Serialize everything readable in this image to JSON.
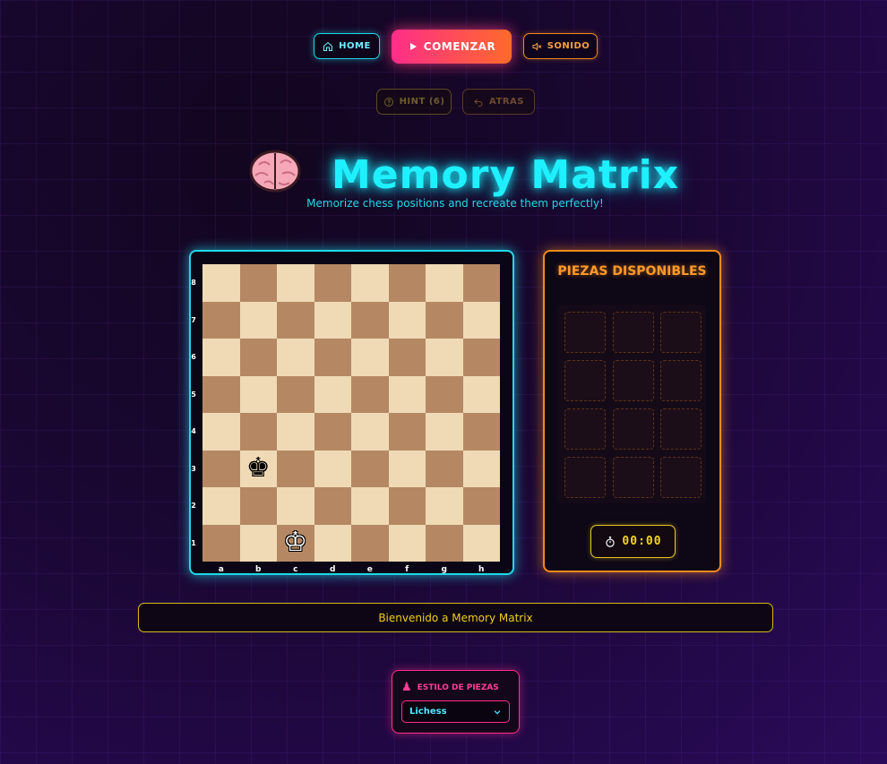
{
  "nav": {
    "home_label": "HOME",
    "start_label": "COMENZAR",
    "sound_label": "SONIDO",
    "hint_label": "HINT (6)",
    "back_label": "ATRAS"
  },
  "header": {
    "title": "Memory Matrix",
    "subtitle": "Memorize chess positions and recreate them perfectly!"
  },
  "board": {
    "ranks": [
      "8",
      "7",
      "6",
      "5",
      "4",
      "3",
      "2",
      "1"
    ],
    "files": [
      "a",
      "b",
      "c",
      "d",
      "e",
      "f",
      "g",
      "h"
    ],
    "pieces": [
      {
        "square": "b3",
        "glyph": "♚",
        "piece": "black-king"
      },
      {
        "square": "c1",
        "glyph": "♔",
        "piece": "white-king"
      }
    ]
  },
  "pieces_panel": {
    "title": "PIEZAS DISPONIBLES",
    "slots_count": 12
  },
  "timer": {
    "value": "00:00"
  },
  "message": "Bienvenido a Memory Matrix",
  "piece_style": {
    "label": "ESTILO DE PIEZAS",
    "selected": "Lichess"
  },
  "colors": {
    "cyan": "#1fd8e8",
    "pink": "#ff2d8a",
    "orange": "#f08a1c",
    "yellow": "#e8c820",
    "light_square": "#efdab5",
    "dark_square": "#b58863"
  }
}
